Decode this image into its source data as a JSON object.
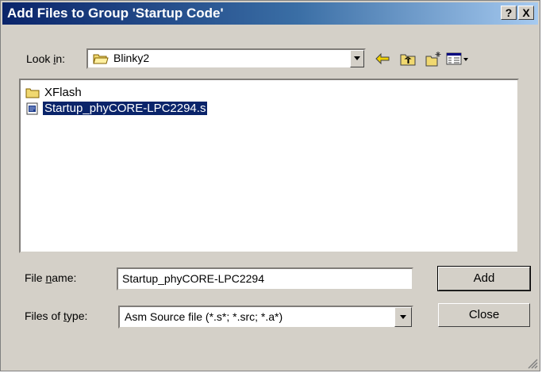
{
  "window": {
    "title": "Add Files to Group 'Startup Code'",
    "help_label": "?",
    "close_label": "X"
  },
  "lookin": {
    "label_pre": "Look ",
    "label_accel": "i",
    "label_post": "n:",
    "value": "Blinky2"
  },
  "toolbar": {
    "icons": [
      "back-arrow-icon",
      "up-one-level-icon",
      "new-folder-icon",
      "view-menu-icon"
    ]
  },
  "files": [
    {
      "name": "XFlash",
      "type": "folder",
      "selected": false
    },
    {
      "name": "Startup_phyCORE-LPC2294.s",
      "type": "asm-file",
      "selected": true
    }
  ],
  "filename": {
    "label_pre": "File ",
    "label_accel": "n",
    "label_post": "ame:",
    "value": "Startup_phyCORE-LPC2294"
  },
  "filetype": {
    "label_pre": "Files of ",
    "label_accel": "t",
    "label_post": "ype:",
    "value": "Asm Source file (*.s*; *.src; *.a*)"
  },
  "buttons": {
    "add": "Add",
    "close": "Close"
  },
  "colors": {
    "title_start": "#0a246a",
    "title_end": "#a6caf0",
    "face": "#d4d0c8",
    "selection": "#0a246a"
  }
}
